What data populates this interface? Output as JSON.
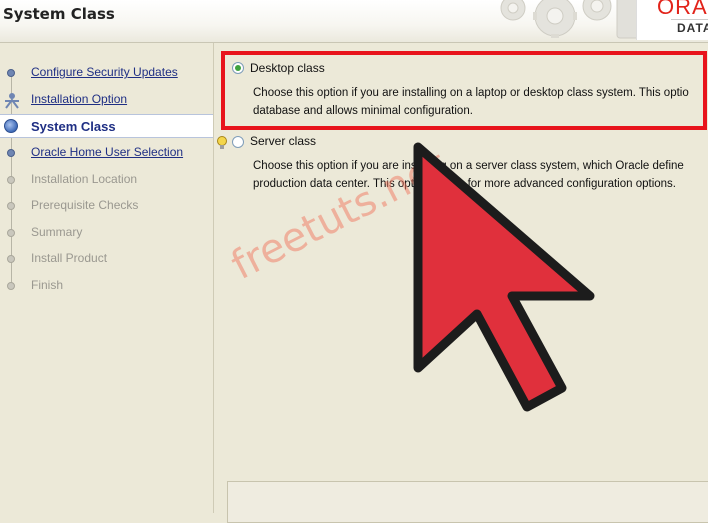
{
  "header": {
    "title": "System Class",
    "brand_name": "ORACLE",
    "brand_sub": "DATABASE"
  },
  "sidebar": {
    "steps": [
      {
        "label": "Configure Security Updates",
        "state": "done"
      },
      {
        "label": "Installation Option",
        "state": "done"
      },
      {
        "label": "System Class",
        "state": "current"
      },
      {
        "label": "Oracle Home User Selection",
        "state": "done"
      },
      {
        "label": "Installation Location",
        "state": "pending"
      },
      {
        "label": "Prerequisite Checks",
        "state": "pending"
      },
      {
        "label": "Summary",
        "state": "pending"
      },
      {
        "label": "Install Product",
        "state": "pending"
      },
      {
        "label": "Finish",
        "state": "pending"
      }
    ]
  },
  "main": {
    "options": [
      {
        "title": "Desktop class",
        "selected": true,
        "desc_lines": [
          "Choose this option if you are installing on a laptop or desktop class system. This optio",
          "database and allows minimal configuration."
        ]
      },
      {
        "title": "Server class",
        "selected": false,
        "desc_lines": [
          "Choose this option if you are installing on a server class system, which Oracle define",
          "production data center. This option allows for more advanced configuration options."
        ]
      }
    ]
  },
  "overlay": {
    "watermark": "freetuts.net",
    "arrow_color": "#e0303c",
    "highlight_color": "#e8141c"
  },
  "colors": {
    "background": "#ece9d8",
    "link": "#1f2f84",
    "disabled": "#9a9890",
    "brand": "#e2231a"
  }
}
